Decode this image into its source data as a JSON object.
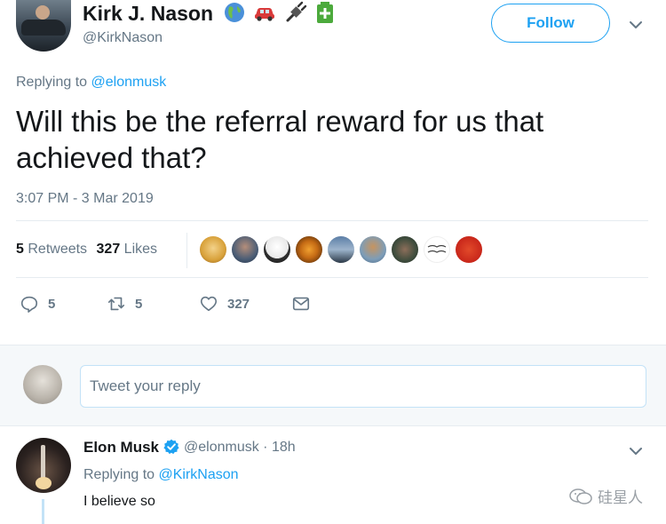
{
  "tweet": {
    "author_name": "Kirk J. Nason",
    "author_handle": "@KirkNason",
    "name_emojis": [
      "globe-icon",
      "car-icon",
      "plug-icon",
      "battery-icon"
    ],
    "follow_label": "Follow",
    "replying_prefix": "Replying to",
    "replying_mention": "@elonmusk",
    "text": "Will this be the referral reward for us that achieved that?",
    "timestamp": "3:07 PM - 3 Mar 2019",
    "retweets_count": "5",
    "retweets_label": "Retweets",
    "likes_count": "327",
    "likes_label": "Likes",
    "liker_count_shown": 9,
    "actions": {
      "reply_count": "5",
      "retweet_count": "5",
      "like_count": "327"
    }
  },
  "reply_box": {
    "placeholder": "Tweet your reply"
  },
  "reply": {
    "author_name": "Elon Musk",
    "author_handle": "@elonmusk",
    "separator": "·",
    "age": "18h",
    "replying_prefix": "Replying to",
    "replying_mention": "@KirkNason",
    "text": "I believe so"
  },
  "watermark": {
    "text": "硅星人"
  },
  "colors": {
    "accent": "#1da1f2",
    "secondary_text": "#657786",
    "primary_text": "#14171a",
    "divider": "#e6ecf0",
    "reply_area_bg": "#f5f8fa"
  }
}
